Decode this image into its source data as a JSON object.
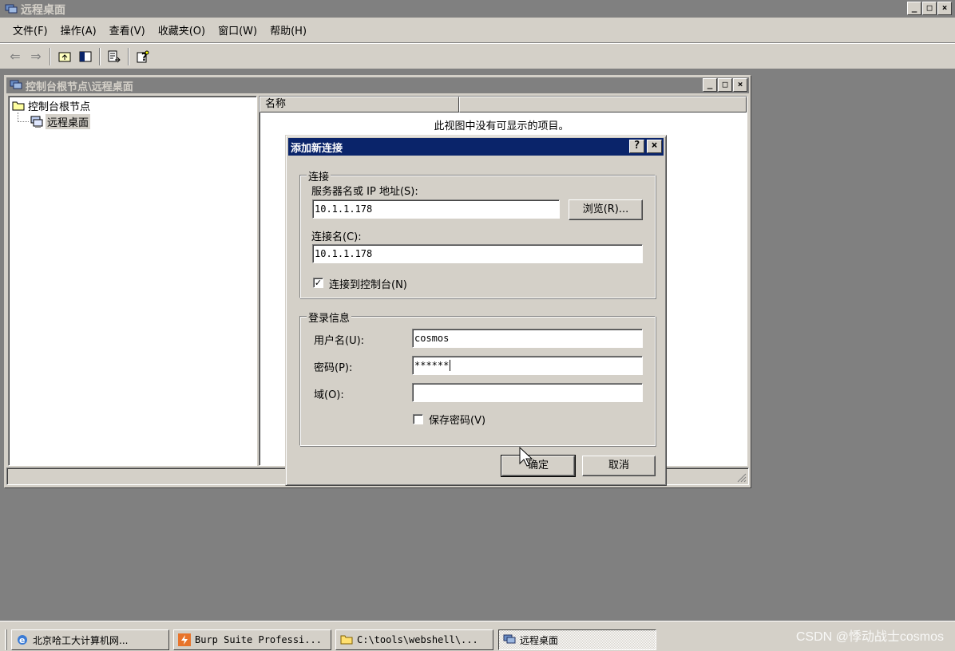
{
  "app": {
    "title": "远程桌面"
  },
  "window_controls": {
    "minimize": "_",
    "restore": "□",
    "close": "×"
  },
  "menu": {
    "items": [
      "文件(F)",
      "操作(A)",
      "查看(V)",
      "收藏夹(O)",
      "窗口(W)",
      "帮助(H)"
    ]
  },
  "toolbar": {
    "icons": [
      "back-arrow",
      "forward-arrow",
      "up-folder",
      "show-hide-tree",
      "export-list",
      "help"
    ]
  },
  "child_window": {
    "title": "控制台根节点\\远程桌面",
    "tree": {
      "root": "控制台根节点",
      "child": "远程桌面"
    },
    "list": {
      "column_name": "名称",
      "empty_message": "此视图中没有可显示的项目。"
    }
  },
  "dialog": {
    "title": "添加新连接",
    "help_btn": "?",
    "close_btn": "×",
    "connection_group": {
      "legend": "连接",
      "server_label": "服务器名或 IP 地址(S):",
      "server_value": "10.1.1.178",
      "browse_button": "浏览(R)...",
      "name_label": "连接名(C):",
      "name_value": "10.1.1.178",
      "console_checkbox_label": "连接到控制台(N)",
      "console_checked": true
    },
    "login_group": {
      "legend": "登录信息",
      "username_label": "用户名(U):",
      "username_value": "cosmos",
      "password_label": "密码(P):",
      "password_value": "******",
      "domain_label": "域(O):",
      "domain_value": "",
      "save_password_label": "保存密码(V)",
      "save_password_checked": false
    },
    "ok_button": "确定",
    "cancel_button": "取消"
  },
  "taskbar": {
    "tasks": [
      {
        "label": "北京哈工大计算机网...",
        "icon": "ie-icon",
        "active": false
      },
      {
        "label": "Burp Suite Professi...",
        "icon": "burp-icon",
        "active": false
      },
      {
        "label": "C:\\tools\\webshell\\...",
        "icon": "folder-icon",
        "active": false
      },
      {
        "label": "远程桌面",
        "icon": "remote-desktop-icon",
        "active": true
      }
    ]
  },
  "watermark": "CSDN @悸动战士cosmos"
}
